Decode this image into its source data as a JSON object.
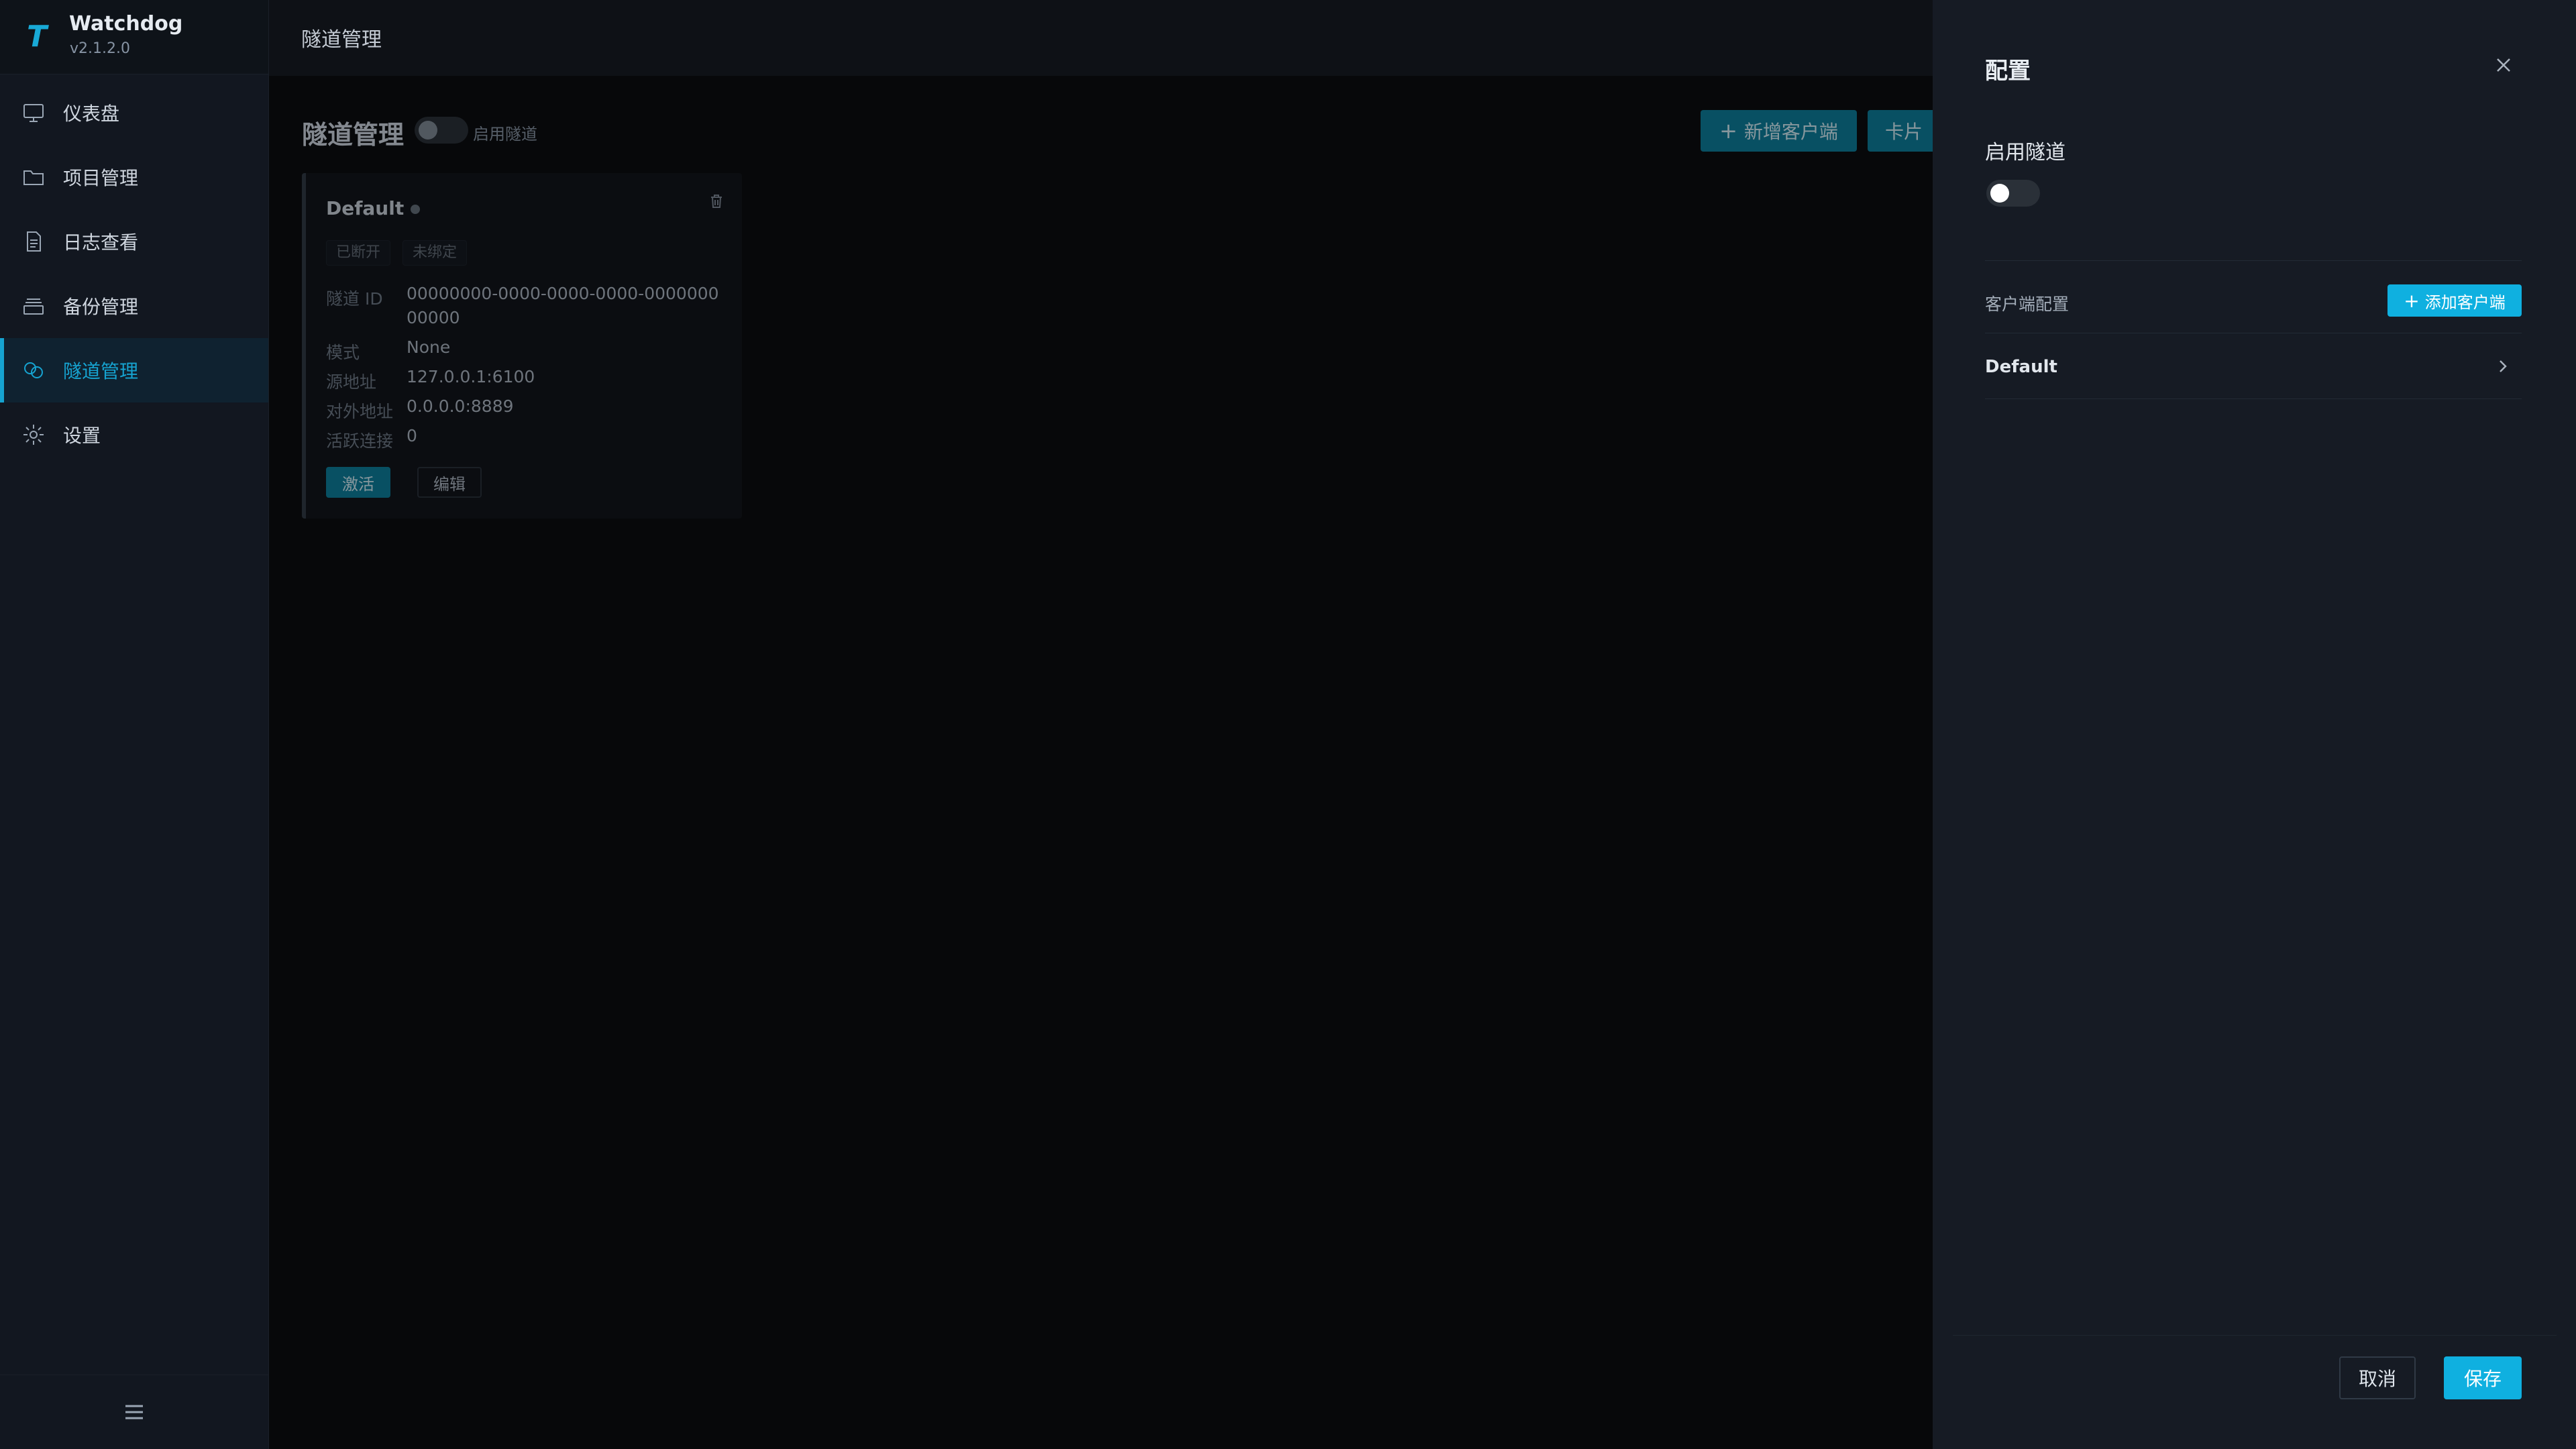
{
  "app": {
    "name": "Watchdog",
    "version": "v2.1.2.0",
    "logo_letter": "T"
  },
  "sidebar": {
    "items": [
      {
        "label": "仪表盘",
        "icon": "monitor-icon"
      },
      {
        "label": "项目管理",
        "icon": "folder-icon"
      },
      {
        "label": "日志查看",
        "icon": "document-icon"
      },
      {
        "label": "备份管理",
        "icon": "archive-icon"
      },
      {
        "label": "隧道管理",
        "icon": "tunnel-icon",
        "active": true
      },
      {
        "label": "设置",
        "icon": "gear-icon"
      }
    ]
  },
  "header": {
    "title": "隧道管理"
  },
  "main": {
    "title": "隧道管理",
    "toggle_label": "启用隧道",
    "toggle_on": false,
    "add_client_label": "新增客户端",
    "view_label": "卡片"
  },
  "card": {
    "title": "Default",
    "tags": [
      "已断开",
      "未绑定"
    ],
    "fields": [
      {
        "key": "隧道 ID",
        "value": "00000000-0000-0000-0000-000000000000"
      },
      {
        "key": "模式",
        "value": "None"
      },
      {
        "key": "源地址",
        "value": "127.0.0.1:6100"
      },
      {
        "key": "对外地址",
        "value": "0.0.0.0:8889"
      },
      {
        "key": "活跃连接",
        "value": "0"
      }
    ],
    "activate_label": "激活",
    "edit_label": "编辑"
  },
  "drawer": {
    "title": "配置",
    "enable_label": "启用隧道",
    "enable_on": false,
    "section_label": "客户端配置",
    "add_client_label": "添加客户端",
    "clients": [
      {
        "name": "Default"
      }
    ],
    "cancel_label": "取消",
    "save_label": "保存"
  },
  "colors": {
    "accent": "#0fb0e0",
    "accent_dark": "#0d7c98",
    "drawer_bg": "#161b24",
    "sidebar_bg": "#121720"
  }
}
